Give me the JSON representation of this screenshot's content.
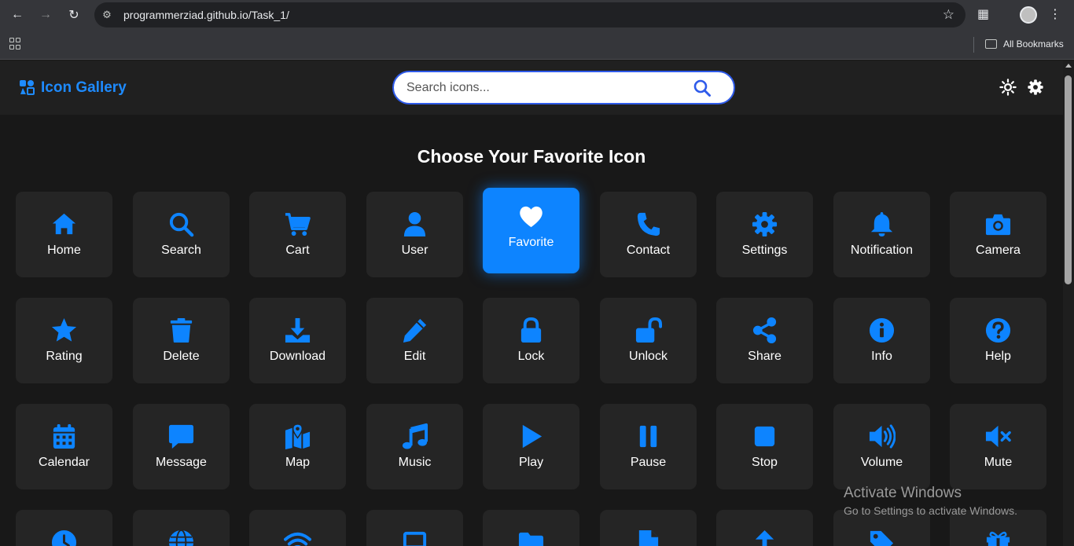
{
  "browser": {
    "url": "programmerziad.github.io/Task_1/",
    "bookmarks_label": "All Bookmarks"
  },
  "header": {
    "brand": "Icon Gallery",
    "search_placeholder": "Search icons..."
  },
  "main": {
    "title": "Choose Your Favorite Icon",
    "accent_color": "#0d84ff",
    "icons": [
      {
        "label": "Home",
        "icon": "home-icon"
      },
      {
        "label": "Search",
        "icon": "search-icon"
      },
      {
        "label": "Cart",
        "icon": "cart-icon"
      },
      {
        "label": "User",
        "icon": "user-icon"
      },
      {
        "label": "Favorite",
        "icon": "heart-icon",
        "active": true
      },
      {
        "label": "Contact",
        "icon": "phone-icon"
      },
      {
        "label": "Settings",
        "icon": "gear-icon"
      },
      {
        "label": "Notification",
        "icon": "bell-icon"
      },
      {
        "label": "Camera",
        "icon": "camera-icon"
      },
      {
        "label": "Rating",
        "icon": "star-icon"
      },
      {
        "label": "Delete",
        "icon": "trash-icon"
      },
      {
        "label": "Download",
        "icon": "download-icon"
      },
      {
        "label": "Edit",
        "icon": "pencil-icon"
      },
      {
        "label": "Lock",
        "icon": "lock-icon"
      },
      {
        "label": "Unlock",
        "icon": "unlock-icon"
      },
      {
        "label": "Share",
        "icon": "share-icon"
      },
      {
        "label": "Info",
        "icon": "info-icon"
      },
      {
        "label": "Help",
        "icon": "help-icon"
      },
      {
        "label": "Calendar",
        "icon": "calendar-icon"
      },
      {
        "label": "Message",
        "icon": "message-icon"
      },
      {
        "label": "Map",
        "icon": "map-icon"
      },
      {
        "label": "Music",
        "icon": "music-icon"
      },
      {
        "label": "Play",
        "icon": "play-icon"
      },
      {
        "label": "Pause",
        "icon": "pause-icon"
      },
      {
        "label": "Stop",
        "icon": "stop-icon"
      },
      {
        "label": "Volume",
        "icon": "volume-icon"
      },
      {
        "label": "Mute",
        "icon": "mute-icon"
      }
    ],
    "partial_row_icons": [
      "clock-icon",
      "globe-icon",
      "wifi-icon",
      "laptop-icon",
      "folder-icon",
      "file-icon",
      "upload-icon",
      "tag-icon",
      "gift-icon"
    ]
  },
  "watermark": {
    "line1": "Activate Windows",
    "line2": "Go to Settings to activate Windows."
  }
}
